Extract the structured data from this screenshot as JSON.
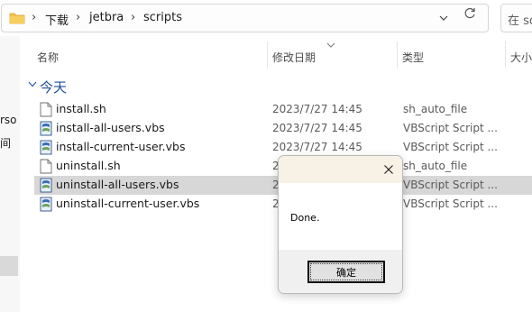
{
  "address_bar": {
    "breadcrumbs": [
      "下载",
      "jetbra",
      "scripts"
    ],
    "separator": "›",
    "folder_icon": "folder-icon",
    "chevron_icon": "chevron-down-icon",
    "refresh_icon": "refresh-icon",
    "search_placeholder": "在 sc"
  },
  "nav_pane": {
    "fragment_1": "rso",
    "fragment_2": "间"
  },
  "columns": {
    "name": "名称",
    "date_modified": "修改日期",
    "type": "类型",
    "size": "大小"
  },
  "group": {
    "label": "今天"
  },
  "files": [
    {
      "name": "install.sh",
      "date": "2023/7/27 14:45",
      "type": "sh_auto_file",
      "icon": "document-icon"
    },
    {
      "name": "install-all-users.vbs",
      "date": "2023/7/27 14:45",
      "type": "VBScript Script ...",
      "icon": "vbscript-icon"
    },
    {
      "name": "install-current-user.vbs",
      "date": "2023/7/27 14:45",
      "type": "VBScript Script ...",
      "icon": "vbscript-icon"
    },
    {
      "name": "uninstall.sh",
      "date": "2",
      "type": "sh_auto_file",
      "icon": "document-icon"
    },
    {
      "name": "uninstall-all-users.vbs",
      "date": "2",
      "type": "VBScript Script ...",
      "icon": "vbscript-icon",
      "selected": true
    },
    {
      "name": "uninstall-current-user.vbs",
      "date": "2",
      "type": "VBScript Script ...",
      "icon": "vbscript-icon"
    }
  ],
  "dialog": {
    "message": "Done.",
    "ok_label": "确定",
    "close_icon": "close-icon",
    "titlebar_color": "#f8f1e6"
  },
  "colors": {
    "selected_row": "#d7d7d7",
    "group_label": "#1f4e9a"
  }
}
